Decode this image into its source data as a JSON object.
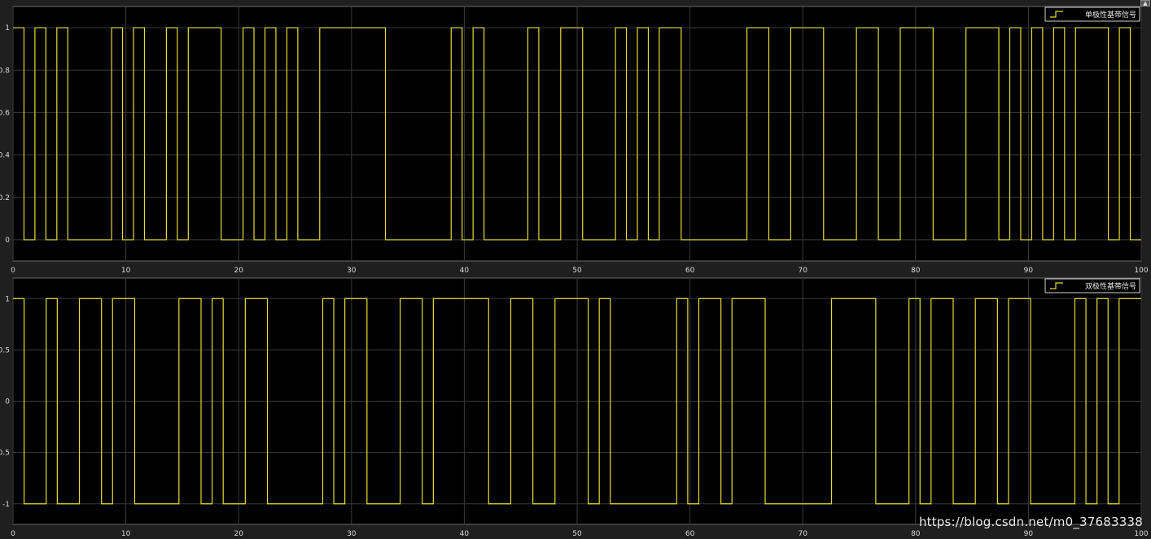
{
  "colors": {
    "background": "#1f1f1f",
    "plot_area": "#000000",
    "grid": "#3a3a3a",
    "signal": "#e6dc32",
    "tick_text": "#d9d9d9"
  },
  "watermark": "https://blog.csdn.net/m0_37683338",
  "icons": {
    "corner": "expand-icon"
  },
  "chart_data": [
    {
      "type": "line",
      "step": true,
      "xlim": [
        0,
        100
      ],
      "ylim": [
        -0.1,
        1.1
      ],
      "grid": true,
      "legend_position": "top-right",
      "x_ticks": [
        "0",
        "10",
        "20",
        "30",
        "40",
        "50",
        "60",
        "70",
        "80",
        "90",
        "100"
      ],
      "y_ticks": [
        {
          "value": 1,
          "label": "1"
        },
        {
          "value": 0.8,
          "label": "0.8"
        },
        {
          "value": 0.6,
          "label": "0.6"
        },
        {
          "value": 0.4,
          "label": "0.4"
        },
        {
          "value": 0.2,
          "label": "0.2"
        },
        {
          "value": 0,
          "label": "0"
        }
      ],
      "series": [
        {
          "name": "单极性基带信号",
          "levels": [
            1,
            0,
            1,
            0,
            1,
            0,
            0,
            0,
            0,
            1,
            0,
            1,
            0,
            0,
            1,
            0,
            1,
            1,
            1,
            0,
            0,
            1,
            0,
            1,
            0,
            1,
            0,
            0,
            1,
            1,
            1,
            1,
            1,
            1,
            0,
            0,
            0,
            0,
            0,
            0,
            1,
            0,
            1,
            0,
            0,
            0,
            0,
            1,
            0,
            0,
            1,
            1,
            0,
            0,
            0,
            1,
            0,
            1,
            0,
            1,
            1,
            0,
            0,
            0,
            0,
            0,
            0,
            1,
            1,
            0,
            0,
            1,
            1,
            1,
            0,
            0,
            0,
            1,
            1,
            0,
            0,
            1,
            1,
            1,
            0,
            0,
            0,
            1,
            1,
            1,
            0,
            1,
            0,
            1,
            0,
            1,
            0,
            1,
            1,
            1,
            0,
            1,
            0
          ]
        }
      ]
    },
    {
      "type": "line",
      "step": true,
      "xlim": [
        0,
        100
      ],
      "ylim": [
        -1.2,
        1.2
      ],
      "grid": true,
      "legend_position": "top-right",
      "x_ticks": [
        "0",
        "10",
        "20",
        "30",
        "40",
        "50",
        "60",
        "70",
        "80",
        "90",
        "100"
      ],
      "y_ticks": [
        {
          "value": 1,
          "label": "1"
        },
        {
          "value": 0.5,
          "label": "0.5"
        },
        {
          "value": 0,
          "label": "0"
        },
        {
          "value": -0.5,
          "label": "0.5"
        },
        {
          "value": -1,
          "label": "-1"
        }
      ],
      "series": [
        {
          "name": "双极性基带信号",
          "levels": [
            1,
            -1,
            -1,
            1,
            -1,
            -1,
            1,
            1,
            -1,
            1,
            1,
            -1,
            -1,
            -1,
            -1,
            1,
            1,
            -1,
            1,
            -1,
            -1,
            1,
            1,
            -1,
            -1,
            -1,
            -1,
            -1,
            1,
            -1,
            1,
            1,
            -1,
            -1,
            -1,
            1,
            1,
            -1,
            1,
            1,
            1,
            1,
            1,
            -1,
            -1,
            1,
            1,
            -1,
            -1,
            1,
            1,
            1,
            -1,
            1,
            -1,
            -1,
            -1,
            -1,
            -1,
            -1,
            1,
            -1,
            1,
            1,
            -1,
            1,
            1,
            1,
            -1,
            -1,
            -1,
            -1,
            -1,
            -1,
            1,
            1,
            1,
            1,
            -1,
            -1,
            -1,
            1,
            -1,
            1,
            1,
            -1,
            -1,
            1,
            1,
            -1,
            1,
            1,
            -1,
            -1,
            -1,
            -1,
            1,
            -1,
            1,
            -1,
            1,
            1
          ]
        }
      ]
    }
  ]
}
